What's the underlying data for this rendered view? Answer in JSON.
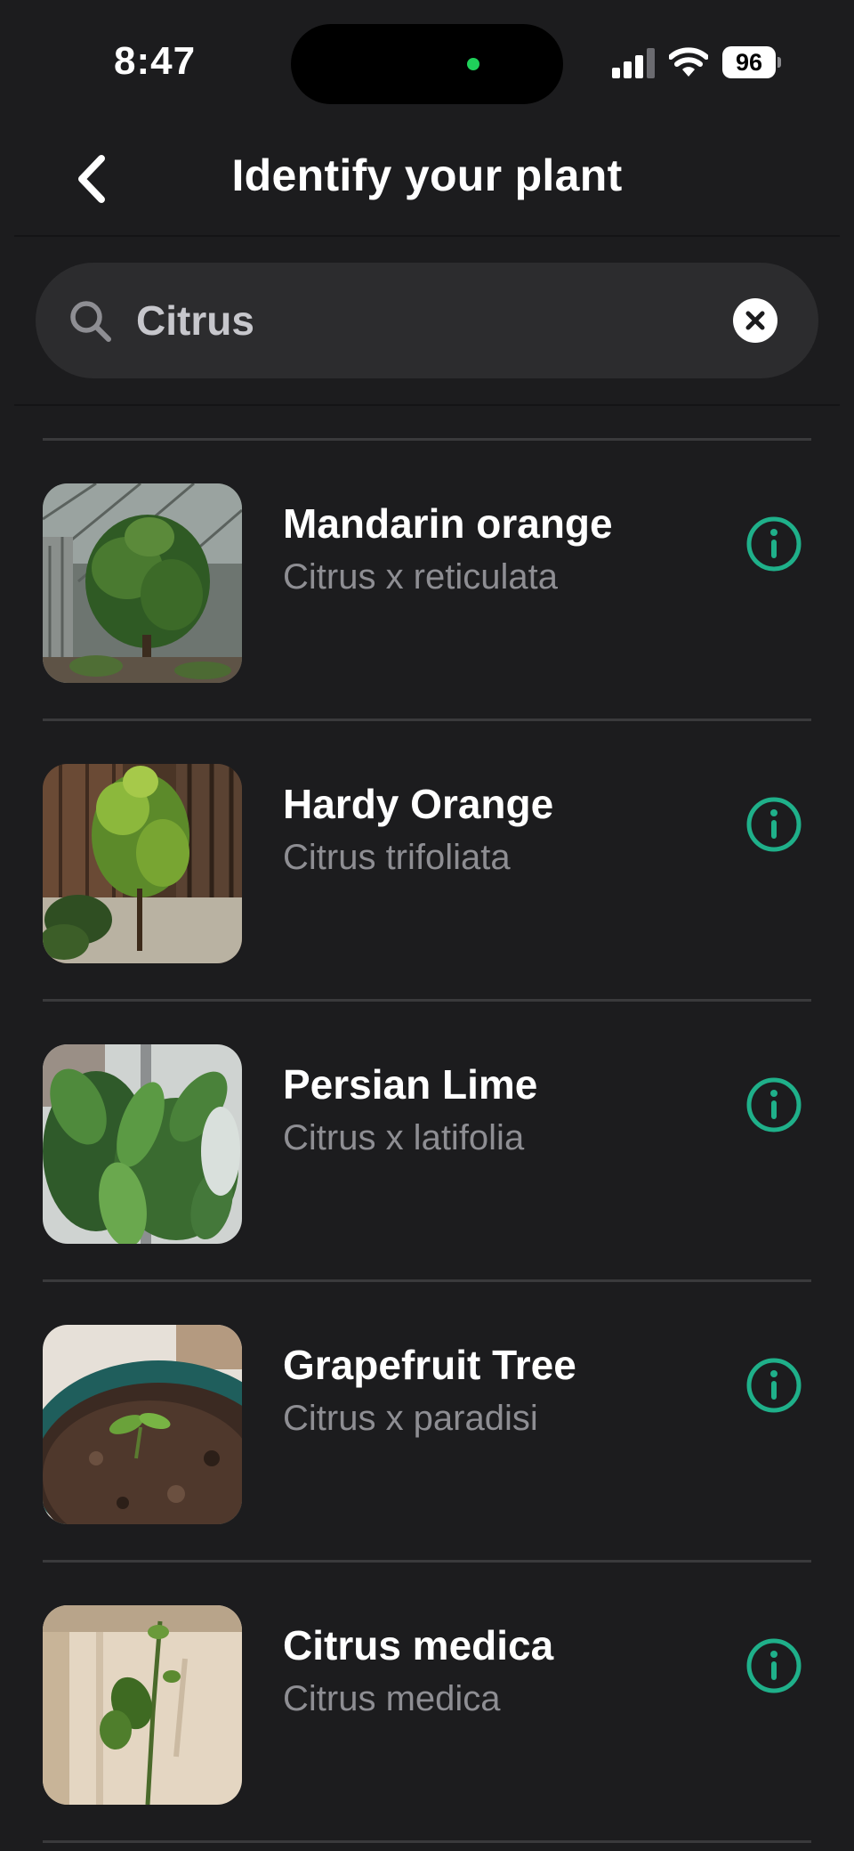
{
  "status_bar": {
    "time": "8:47",
    "battery": "96"
  },
  "header": {
    "title": "Identify your plant"
  },
  "search": {
    "value": "Citrus",
    "placeholder": "Search"
  },
  "colors": {
    "background": "#1c1c1e",
    "search_bg": "#2c2c2e",
    "accent": "#1fb08a",
    "secondary_text": "#8e8e93"
  },
  "results": [
    {
      "name": "Mandarin orange",
      "scientific": "Citrus x reticulata",
      "thumb": "greenhouse-shrub"
    },
    {
      "name": "Hardy Orange",
      "scientific": "Citrus trifoliata",
      "thumb": "fence-shrub"
    },
    {
      "name": "Persian Lime",
      "scientific": "Citrus x latifolia",
      "thumb": "leafy-branch"
    },
    {
      "name": "Grapefruit Tree",
      "scientific": "Citrus x paradisi",
      "thumb": "seedling-pot"
    },
    {
      "name": "Citrus medica",
      "scientific": "Citrus medica",
      "thumb": "wall-sprout"
    }
  ]
}
